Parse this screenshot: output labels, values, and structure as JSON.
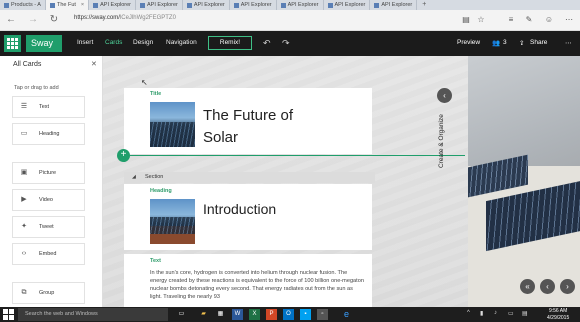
{
  "browser": {
    "tabs": [
      {
        "label": "Products - A",
        "active": false
      },
      {
        "label": "The Fut",
        "active": true
      },
      {
        "label": "API Explorer",
        "active": false
      },
      {
        "label": "API Explorer",
        "active": false
      },
      {
        "label": "API Explorer",
        "active": false
      },
      {
        "label": "API Explorer",
        "active": false
      },
      {
        "label": "API Explorer",
        "active": false
      },
      {
        "label": "API Explorer",
        "active": false
      },
      {
        "label": "API Explorer",
        "active": false
      }
    ],
    "new_tab": "+",
    "url_domain": "https://sway.com/",
    "url_path": "lCeJlhWg2FEGPTZ0"
  },
  "app": {
    "brand": "Sway",
    "menu": [
      "Insert",
      "Cards",
      "Design",
      "Navigation"
    ],
    "active_menu": "Cards",
    "remix": "Remix!",
    "preview": "Preview",
    "share_count": "3",
    "share": "Share"
  },
  "cards_panel": {
    "title": "All Cards",
    "close": "✕",
    "hint": "Tap or drag to add",
    "items": [
      {
        "label": "Text",
        "icon": "text-icon"
      },
      {
        "label": "Heading",
        "icon": "heading-icon"
      },
      {
        "label": "Picture",
        "icon": "picture-icon"
      },
      {
        "label": "Video",
        "icon": "video-icon"
      },
      {
        "label": "Tweet",
        "icon": "twitter-icon"
      },
      {
        "label": "Embed",
        "icon": "embed-icon"
      },
      {
        "label": "Group",
        "icon": "group-icon"
      }
    ]
  },
  "canvas": {
    "title_card": {
      "label": "Title",
      "heading_line1": "The Future of",
      "heading_line2": "Solar"
    },
    "section": {
      "label": "Section"
    },
    "heading_card": {
      "label": "Heading",
      "heading": "Introduction"
    },
    "text_card": {
      "label": "Text",
      "body": "In the sun's core, hydrogen is converted into helium through nuclear fusion. The energy created by these reactions is equivalent to the force of 100 billion one-megaton nuclear bombs detonating every second. That energy radiates out from the sun as light. Traveling the nearly 93"
    },
    "storyline_label": "Create & Organize"
  },
  "taskbar": {
    "search_placeholder": "Search the web and Windows",
    "time": "9:56 AM",
    "date": "4/29/2015"
  },
  "colors": {
    "accent": "#1f9e6b",
    "commandbar": "#1b1b1b"
  }
}
